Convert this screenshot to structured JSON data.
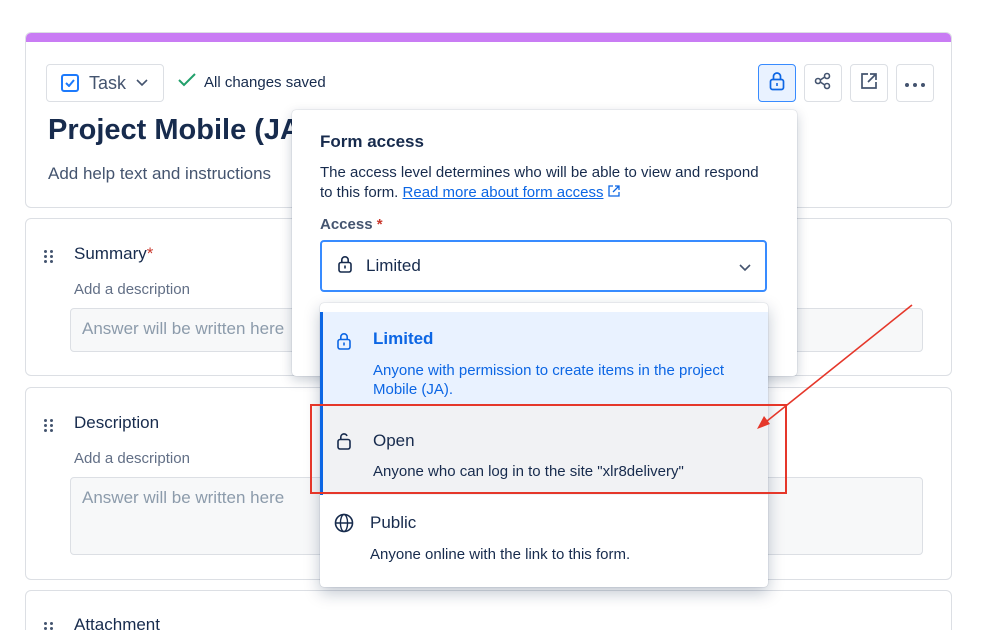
{
  "header": {
    "type_label": "Task",
    "save_status": "All changes saved",
    "title": "Project Mobile (JA",
    "help_text": "Add help text and instructions",
    "accent_color": "#c97cf4",
    "toolbar_icons": [
      "lock-icon",
      "share-icon",
      "open-external-icon",
      "more-icon"
    ]
  },
  "fields": [
    {
      "label": "Summary",
      "required": "*",
      "description": "Add a description",
      "placeholder": "Answer will be written here"
    },
    {
      "label": "Description",
      "description": "Add a description",
      "placeholder": "Answer will be written here"
    },
    {
      "label": "Attachment"
    }
  ],
  "popup": {
    "title": "Form access",
    "body": "The access level determines who will be able to view and respond to this form.",
    "link": "Read more about form access",
    "access_label": "Access",
    "required_mark": "*",
    "selected_value": "Limited"
  },
  "menu": {
    "options": [
      {
        "title": "Limited",
        "description": "Anyone with permission to create items in the project Mobile (JA).",
        "icon": "lock-icon",
        "state": "selected"
      },
      {
        "title": "Open",
        "description": "Anyone who can log in to the site \"xlr8delivery\"",
        "icon": "unlock-icon",
        "state": "hover"
      },
      {
        "title": "Public",
        "description": "Anyone online with the link to this form.",
        "icon": "globe-icon",
        "state": "default"
      }
    ]
  },
  "annotation": {
    "color": "#e5372a"
  }
}
